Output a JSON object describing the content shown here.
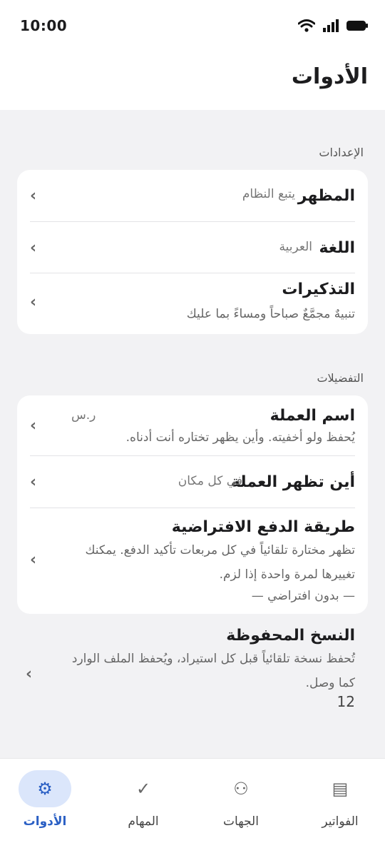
{
  "status_bar": {
    "time": "10:00"
  },
  "header": {
    "title": "الأدوات"
  },
  "sections": {
    "settings": {
      "title": "الإعدادات",
      "appearance": {
        "title": "المظهر",
        "value": "يتبع النظام"
      },
      "language": {
        "title": "اللغة",
        "value": "العربية"
      },
      "reminders": {
        "title": "التذكيرات",
        "subtitle": "تنبيهٌ مجمَّعٌ صباحاً ومساءً بما عليك"
      }
    },
    "preferences": {
      "title": "التفضيلات",
      "currency_name": {
        "title": "اسم العملة",
        "value": "ر.س",
        "subtitle": "يُحفظ ولو أخفيته. وأين يظهر تختاره أنت أدناه."
      },
      "currency_position": {
        "title": "أين تظهر العملة",
        "value": "في كل مكان"
      },
      "default_payment": {
        "title": "طريقة الدفع الافتراضية",
        "subtitle_line1": "تظهر مختارة تلقائياً في كل مربعات تأكيد الدفع. يمكنك",
        "subtitle_line2": "تغييرها لمرة واحدة إذا لزم.",
        "value": "— بدون افتراضي —"
      }
    },
    "backups": {
      "title": "النسخ المحفوظة",
      "subtitle_line1": "تُحفظ نسخة تلقائياً قبل كل استيراد، ويُحفظ الملف الوارد",
      "subtitle_line2": "كما وصل.",
      "count": "12"
    }
  },
  "bottom_nav": {
    "tools": "الأدوات",
    "tasks": "المهام",
    "contacts": "الجهات",
    "invoices": "الفواتير"
  }
}
